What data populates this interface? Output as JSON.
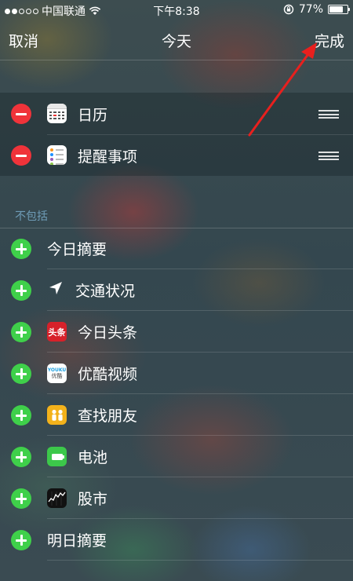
{
  "status_bar": {
    "carrier": "中国联通",
    "time": "下午8:38",
    "battery": "77%",
    "battery_level": 0.77,
    "signal_dots": 2
  },
  "nav": {
    "cancel_label": "取消",
    "title": "今天",
    "done_label": "完成"
  },
  "included": [
    {
      "label": "日历",
      "icon": "calendar-icon"
    },
    {
      "label": "提醒事项",
      "icon": "reminders-icon"
    }
  ],
  "excluded_header": "不包括",
  "excluded": [
    {
      "label": "今日摘要",
      "icon": ""
    },
    {
      "label": "交通状况",
      "icon": "location-arrow-icon"
    },
    {
      "label": "今日头条",
      "icon": "toutiao-icon",
      "icon_text": "头条"
    },
    {
      "label": "优酷视频",
      "icon": "youku-icon",
      "icon_text_1": "YOUKU",
      "icon_text_2": "优酷"
    },
    {
      "label": "查找朋友",
      "icon": "find-friends-icon"
    },
    {
      "label": "电池",
      "icon": "battery-icon"
    },
    {
      "label": "股市",
      "icon": "stocks-icon"
    },
    {
      "label": "明日摘要",
      "icon": ""
    }
  ],
  "colors": {
    "remove": "#f0333a",
    "add": "#3fd04a",
    "annotation_arrow": "#e8201e"
  }
}
